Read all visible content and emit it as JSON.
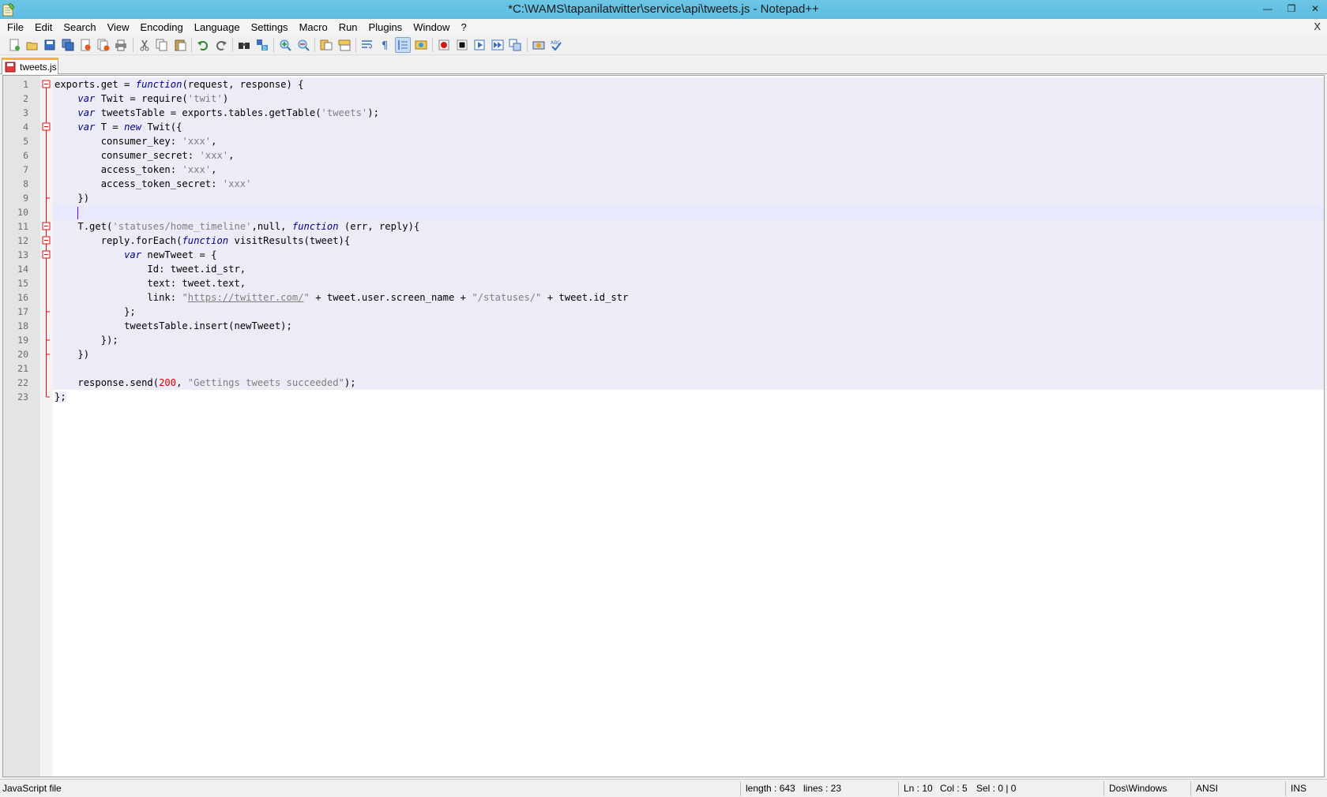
{
  "window": {
    "title": "*C:\\WAMS\\tapanilatwitter\\service\\api\\tweets.js - Notepad++",
    "minimize": "—",
    "restore": "❐",
    "close": "✕",
    "doc_close": "X"
  },
  "menu": [
    "File",
    "Edit",
    "Search",
    "View",
    "Encoding",
    "Language",
    "Settings",
    "Macro",
    "Run",
    "Plugins",
    "Window",
    "?"
  ],
  "toolbar": {
    "icons": [
      "new-file-icon",
      "open-file-icon",
      "save-icon",
      "save-all-icon",
      "close-icon",
      "close-all-icon",
      "print-icon",
      "cut-icon",
      "copy-icon",
      "paste-icon",
      "undo-icon",
      "redo-icon",
      "find-icon",
      "replace-icon",
      "zoom-in-icon",
      "zoom-out-icon",
      "sync-vertical-icon",
      "sync-horizontal-icon",
      "word-wrap-icon",
      "show-all-chars-icon",
      "indent-guide-icon",
      "user-language-icon",
      "record-macro-icon",
      "stop-record-icon",
      "play-macro-icon",
      "run-macro-multiple-icon",
      "save-macro-icon",
      "launch-browser-icon",
      "spell-check-icon"
    ],
    "active": "indent-guide-icon"
  },
  "tab": {
    "label": "tweets.js",
    "icon": "unsaved-file-icon",
    "accent": "#fab041"
  },
  "editor": {
    "current_line": 10,
    "lines": [
      {
        "n": "1"
      },
      {
        "n": "2"
      },
      {
        "n": "3"
      },
      {
        "n": "4"
      },
      {
        "n": "5"
      },
      {
        "n": "6"
      },
      {
        "n": "7"
      },
      {
        "n": "8"
      },
      {
        "n": "9"
      },
      {
        "n": "10"
      },
      {
        "n": "11"
      },
      {
        "n": "12"
      },
      {
        "n": "13"
      },
      {
        "n": "14"
      },
      {
        "n": "15"
      },
      {
        "n": "16"
      },
      {
        "n": "17"
      },
      {
        "n": "18"
      },
      {
        "n": "19"
      },
      {
        "n": "20"
      },
      {
        "n": "21"
      },
      {
        "n": "22"
      },
      {
        "n": "23"
      }
    ],
    "tokens": {
      "l1a": "exports.get = ",
      "l1kw": "function",
      "l1b": "(request, response) {",
      "l2kw": "var",
      "l2a": " Twit = require(",
      "l2s": "'twit'",
      "l2b": ")",
      "l3kw": "var",
      "l3a": " tweetsTable = exports.tables.getTable(",
      "l3s": "'tweets'",
      "l3b": ");",
      "l4kw": "var",
      "l4a": " T = ",
      "l4kw2": "new",
      "l4b": " Twit({",
      "l5a": "consumer_key: ",
      "l5s": "'xxx'",
      "l5b": ",",
      "l6a": "consumer_secret: ",
      "l6s": "'xxx'",
      "l6b": ",",
      "l7a": "access_token: ",
      "l7s": "'xxx'",
      "l7b": ",",
      "l8a": "access_token_secret: ",
      "l8s": "'xxx'",
      "l9a": "})",
      "l11a": "T.get(",
      "l11s": "'statuses/home_timeline'",
      "l11b": ",null, ",
      "l11kw": "function",
      "l11c": " (err, reply){",
      "l12a": "reply.forEach(",
      "l12kw": "function",
      "l12b": " visitResults(tweet){",
      "l13kw": "var",
      "l13a": " newTweet = {",
      "l14a": "Id: tweet.id_str,",
      "l15a": "text: tweet.text,",
      "l16a": "link: ",
      "l16q1": "\"",
      "l16url": "https://twitter.com/",
      "l16q2": "\"",
      "l16b": " + tweet.user.screen_name + ",
      "l16s": "\"/statuses/\"",
      "l16c": " + tweet.id_str",
      "l17a": "};",
      "l18a": "tweetsTable.insert(newTweet);",
      "l19a": "});",
      "l20a": "})",
      "l22a": "response.send(",
      "l22n": "200",
      "l22b": ", ",
      "l22s": "\"Gettings tweets succeeded\"",
      "l22c": ");",
      "l23a": "};"
    }
  },
  "status": {
    "file_type": "JavaScript file",
    "length": "length : 643",
    "lines": "lines : 23",
    "ln": "Ln : 10",
    "col": "Col : 5",
    "sel": "Sel : 0 | 0",
    "eol": "Dos\\Windows",
    "encoding": "ANSI",
    "mode": "INS"
  }
}
